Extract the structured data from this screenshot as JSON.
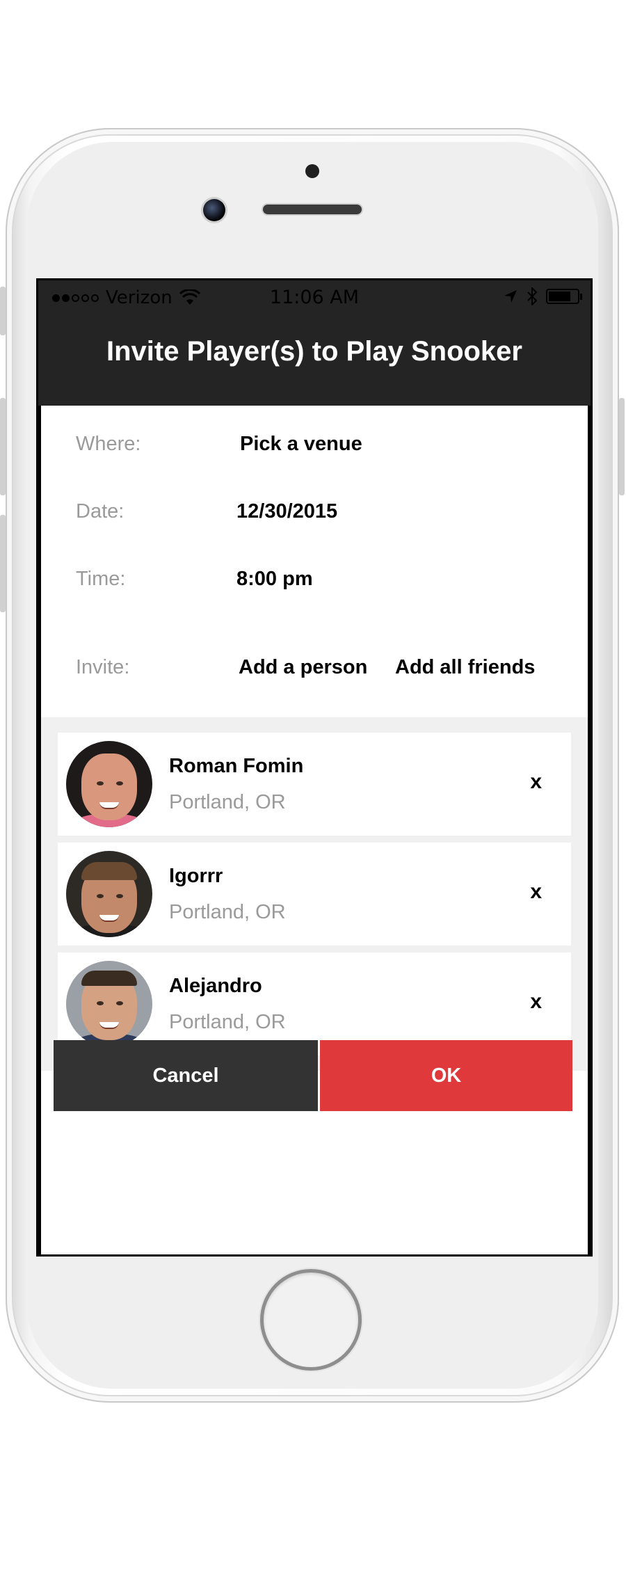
{
  "status_bar": {
    "carrier": "Verizon",
    "time": "11:06 AM",
    "signal_bars_filled": 2,
    "signal_bars_total": 5
  },
  "header": {
    "title": "Invite Player(s) to Play Snooker"
  },
  "form": {
    "where_label": "Where:",
    "where_value": "Pick a venue",
    "date_label": "Date:",
    "date_value": "12/30/2015",
    "time_label": "Time:",
    "time_value": "8:00 pm",
    "invite_label": "Invite:",
    "add_person": "Add a person",
    "add_all_friends": "Add all friends"
  },
  "invitees": [
    {
      "name": "Roman Fomin",
      "location": "Portland, OR",
      "remove": "x"
    },
    {
      "name": "Igorrr",
      "location": "Portland, OR",
      "remove": "x"
    },
    {
      "name": "Alejandro",
      "location": "Portland, OR",
      "remove": "x"
    }
  ],
  "actions": {
    "cancel": "Cancel",
    "ok": "OK"
  },
  "colors": {
    "header_bg": "#242424",
    "cancel_bg": "#333333",
    "ok_bg": "#e0393b",
    "label_gray": "#9a9a9a",
    "list_bg": "#f0f0f0"
  }
}
